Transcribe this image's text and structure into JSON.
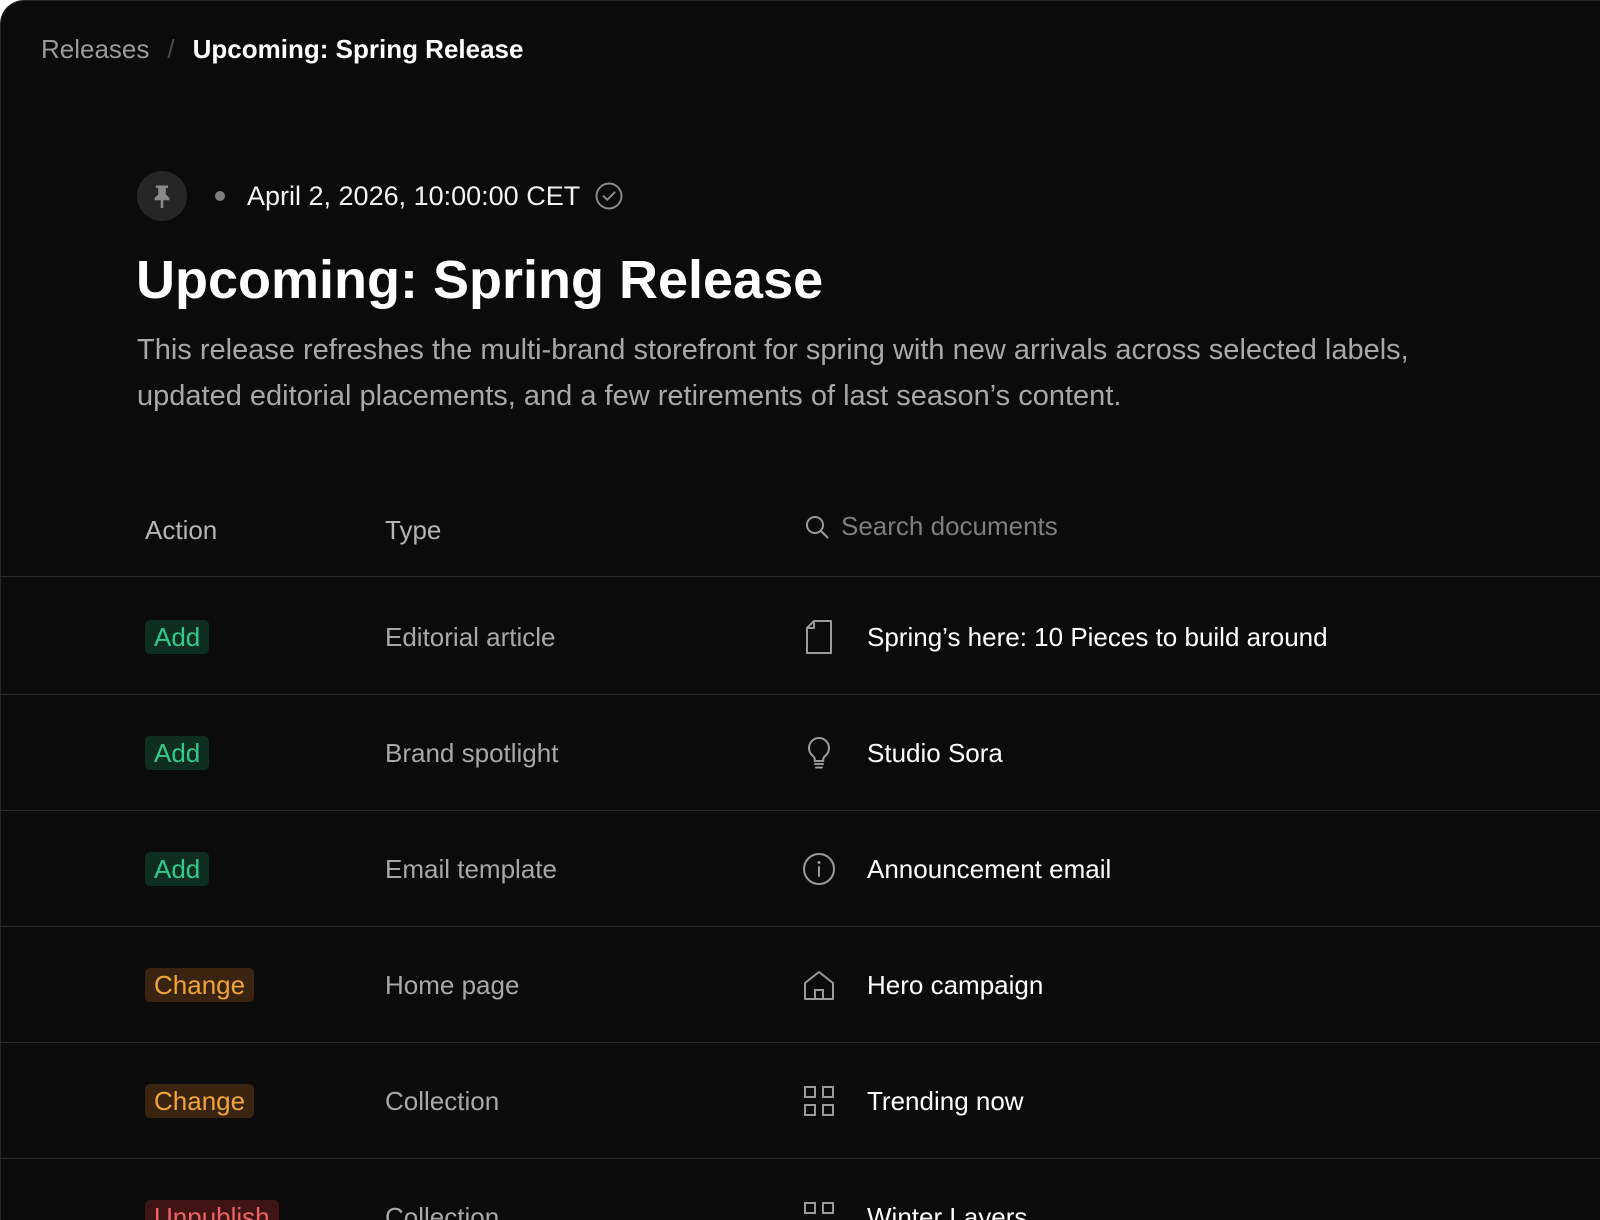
{
  "breadcrumb": {
    "root": "Releases",
    "separator": "/",
    "current": "Upcoming: Spring Release"
  },
  "release": {
    "pin_icon": "pin-icon",
    "scheduled_at": "April 2, 2026, 10:00:00 CET",
    "status_icon": "check-circle-icon",
    "title": "Upcoming: Spring Release",
    "description": "This release refreshes the multi-brand storefront for spring with new arrivals across selected labels, updated editorial placements, and a few retirements of last season’s content."
  },
  "table": {
    "columns": {
      "action": "Action",
      "type": "Type"
    },
    "search": {
      "placeholder": "Search documents",
      "value": "",
      "icon": "search-icon"
    },
    "rows": [
      {
        "action": "Add",
        "action_kind": "add",
        "type": "Editorial article",
        "icon": "document-icon",
        "title": "Spring’s here: 10 Pieces to build around"
      },
      {
        "action": "Add",
        "action_kind": "add",
        "type": "Brand spotlight",
        "icon": "lightbulb-icon",
        "title": "Studio Sora"
      },
      {
        "action": "Add",
        "action_kind": "add",
        "type": "Email template",
        "icon": "info-icon",
        "title": "Announcement email"
      },
      {
        "action": "Change",
        "action_kind": "change",
        "type": "Home page",
        "icon": "home-icon",
        "title": "Hero campaign"
      },
      {
        "action": "Change",
        "action_kind": "change",
        "type": "Collection",
        "icon": "grid-icon",
        "title": "Trending now"
      },
      {
        "action": "Unpublish",
        "action_kind": "unpublish",
        "type": "Collection",
        "icon": "grid-icon",
        "title": "Winter Layers"
      }
    ]
  },
  "colors": {
    "background": "#0b0b0b",
    "add": "#34c98a",
    "change": "#f0a43a",
    "unpublish": "#f06363"
  }
}
